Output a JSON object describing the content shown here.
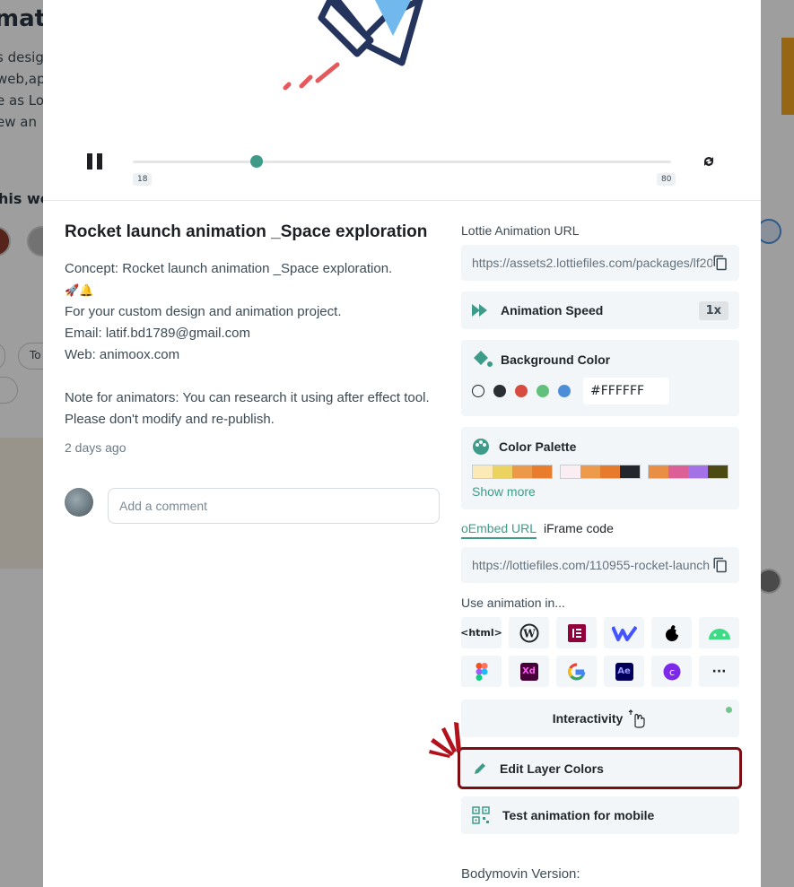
{
  "background": {
    "title_fragment": "mati",
    "text_fragments": [
      "s desig",
      "web,app",
      "e as Lo",
      "ew an"
    ],
    "heading_fragment": "his we",
    "pill_fragment": "To"
  },
  "player": {
    "frame_start": "18",
    "frame_end": "80",
    "progress": 0.23
  },
  "animation": {
    "title": "Rocket launch animation _Space exploration",
    "description_lines": [
      "Concept: Rocket launch animation _Space exploration.",
      "🚀🔔",
      "For your custom design and animation project.",
      "Email: latif.bd1789@gmail.com",
      "Web: animoox.com",
      "",
      "Note for animators: You can research it using after effect tool. Please don't modify and re-publish."
    ],
    "time_ago": "2 days ago"
  },
  "comment": {
    "placeholder": "Add a comment"
  },
  "lottie_url": {
    "label": "Lottie Animation URL",
    "value": "https://assets2.lottiefiles.com/packages/lf20"
  },
  "speed": {
    "label": "Animation Speed",
    "value": "1x"
  },
  "background_color": {
    "label": "Background Color",
    "hex": "#FFFFFF",
    "swatches": [
      "#ffffff",
      "#2a2f33",
      "#d84b3f",
      "#62c07a",
      "#4c8fd8"
    ]
  },
  "color_palette": {
    "label": "Color Palette",
    "show_more": "Show more",
    "palettes": [
      [
        "#fbeab5",
        "#ecd25e",
        "#ec9a4a",
        "#e97c2d"
      ],
      [
        "#fbeef3",
        "#ed9a4b",
        "#e87a2c",
        "#23272b"
      ],
      [
        "#e98f45",
        "#dc6097",
        "#a472e6",
        "#4a4a12"
      ]
    ]
  },
  "embed": {
    "tab_oembed": "oEmbed URL",
    "tab_iframe": "iFrame code",
    "value": "https://lottiefiles.com/110955-rocket-launch"
  },
  "use_in": {
    "label": "Use animation in...",
    "html_tile": "<html>",
    "xd": "Xd",
    "ae": "Ae",
    "more": "···"
  },
  "interactivity": {
    "label": "Interactivity"
  },
  "edit_layers": {
    "label": "Edit Layer Colors"
  },
  "test_mobile": {
    "label": "Test animation for mobile"
  },
  "bodymovin": {
    "label": "Bodymovin Version:"
  },
  "colors": {
    "accent": "#3e9b8a",
    "highlight": "#7b0d13"
  }
}
